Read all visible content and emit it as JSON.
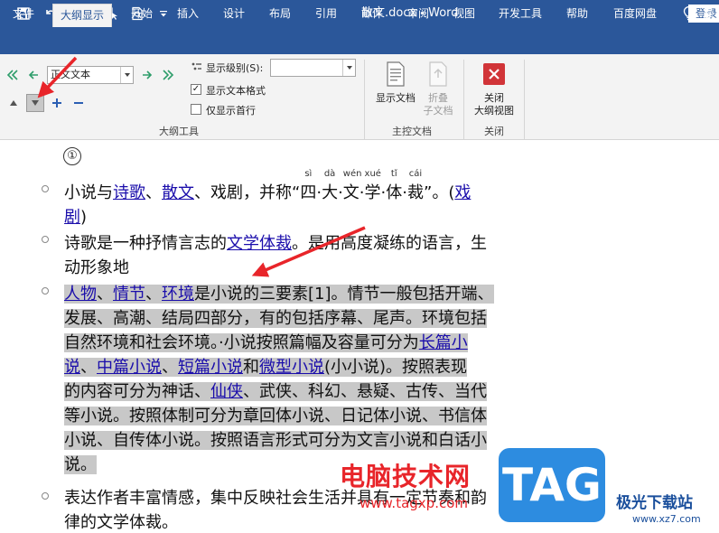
{
  "window": {
    "title": "散文.docx  -  Word",
    "login_label": "登录"
  },
  "tabs": [
    {
      "label": "文件"
    },
    {
      "label": "大纲显示"
    },
    {
      "label": "开始"
    },
    {
      "label": "插入"
    },
    {
      "label": "设计"
    },
    {
      "label": "布局"
    },
    {
      "label": "引用"
    },
    {
      "label": "邮件"
    },
    {
      "label": "审阅"
    },
    {
      "label": "视图"
    },
    {
      "label": "开发工具"
    },
    {
      "label": "帮助"
    },
    {
      "label": "百度网盘"
    },
    {
      "label": "操"
    }
  ],
  "ribbon": {
    "outline_tools": {
      "level_combo_value": "正文文本",
      "show_level_label": "显示级别(S):",
      "show_level_value": "",
      "show_text_format_label": "显示文本格式",
      "show_text_format_checked": true,
      "show_first_line_label": "仅显示首行",
      "show_first_line_checked": false,
      "group_label": "大纲工具"
    },
    "master_document": {
      "show_document_label": "显示文档",
      "collapse_label_1": "折叠",
      "collapse_label_2": "子文档",
      "group_label": "主控文档"
    },
    "close": {
      "close_label_1": "关闭",
      "close_label_2": "大纲视图",
      "group_label": "关闭"
    }
  },
  "document": {
    "circle_number": "①",
    "para1": {
      "line1": {
        "t1": "小说与",
        "l1": "诗歌",
        "t2": "、",
        "l2": "散文",
        "t3": "、戏剧，并称“",
        "r1": {
          "char": "四",
          "py": "sì"
        },
        "r2": {
          "char": "大",
          "py": "dà"
        },
        "r3": {
          "char": "文",
          "py": "wén"
        },
        "r4": {
          "char": "学",
          "py": "xué"
        },
        "r5": {
          "char": "体",
          "py": "tǐ"
        },
        "r6": {
          "char": "裁",
          "py": "cái"
        },
        "t4": "”。(",
        "l3": "戏"
      },
      "line2": {
        "l1": "剧",
        "t1": ")"
      }
    },
    "para2": {
      "line1": {
        "t1": "诗歌是一种抒情言志的",
        "l1": "文学体裁",
        "t2": "。是用高度凝练的语言，生"
      },
      "line2": {
        "t1": "动形象地"
      }
    },
    "para3": {
      "line1": {
        "l1": "人物",
        "t1": "、",
        "l2": "情节",
        "t2": "、",
        "l3": "环境",
        "t3": "是小说的三要素[1]。情节一般包括开端、"
      },
      "line2": {
        "t1": "发展、高潮、结局四部分，有的包括序幕、尾声。环境包括"
      },
      "line3": {
        "t1": "自然环境和社会环境。·小说按照篇幅及容量可分为",
        "l1": "长篇小"
      },
      "line4": {
        "l1": "说",
        "t1": "、",
        "l2": "中篇小说",
        "t2": "、",
        "l3": "短篇小说",
        "t3": "和",
        "l4": "微型小说",
        "t4": "(小小说)。按照表现"
      },
      "line5": {
        "t1": "的内容可分为神话、",
        "l1": "仙侠",
        "t2": "、武侠、科幻、悬疑、古传、当代"
      },
      "line6": {
        "t1": "等小说。按照体制可分为章回体小说、日记体小说、书信体"
      },
      "line7": {
        "t1": "小说、自传体小说。按照语言形式可分为文言小说和白话小"
      },
      "line8": {
        "t1": "说。"
      }
    },
    "para4": {
      "line1": {
        "t1": "表达作者丰富情感，集中反映社会生活并具有一定节奏和韵"
      },
      "line2": {
        "t1": "律的文学体裁。"
      }
    }
  },
  "watermark": {
    "brand_text": "电脑技术网",
    "url_text": "www.tagxp.com",
    "tag_text": "TAG",
    "site_name": "极光下载站",
    "site_url": "www.xz7.com"
  },
  "colors": {
    "word_blue": "#2b579a",
    "link_blue": "#1a0dab",
    "selection_gray": "#c8c8c8",
    "annotation_red": "#e8252a"
  },
  "icons": [
    "save-icon",
    "undo-icon",
    "redo-icon",
    "touch-mode-icon",
    "print-preview-icon",
    "customize-qat-icon",
    "lightbulb-icon",
    "promote-to-heading1-icon",
    "promote-icon",
    "demote-icon",
    "demote-to-body-icon",
    "move-up-icon",
    "move-down-icon",
    "expand-icon",
    "collapse-icon",
    "show-document-icon",
    "collapse-subdocuments-icon",
    "close-outline-view-icon"
  ]
}
